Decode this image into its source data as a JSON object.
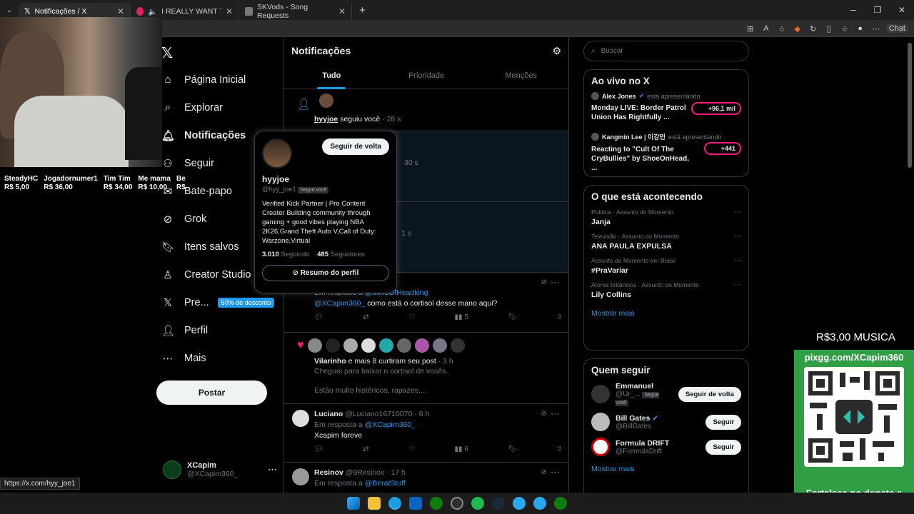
{
  "browser": {
    "tabs": [
      {
        "title": "Notificações / X",
        "active": true
      },
      {
        "title": "I REALLY WANT TO STAY AT Y",
        "active": false
      },
      {
        "title": "SKVods - Song Requests",
        "active": false
      }
    ],
    "chat_label": "Chat"
  },
  "donors": [
    {
      "name": "SteadyHC",
      "amount": "R$ 5,00"
    },
    {
      "name": "Jogadornumer1",
      "amount": "R$ 36,00"
    },
    {
      "name": "Tim Tim",
      "amount": "R$ 34,00"
    },
    {
      "name": "Me mama",
      "amount": "R$ 10,00"
    },
    {
      "name": "Be",
      "amount": "R$"
    }
  ],
  "nav": {
    "items": [
      {
        "label": "Página Inicial",
        "icon": "home-icon"
      },
      {
        "label": "Explorar",
        "icon": "search-icon"
      },
      {
        "label": "Notificações",
        "icon": "bell-icon",
        "active": true
      },
      {
        "label": "Seguir",
        "icon": "follow-icon"
      },
      {
        "label": "Bate-papo",
        "icon": "mail-icon"
      },
      {
        "label": "Grok",
        "icon": "grok-icon"
      },
      {
        "label": "Itens salvos",
        "icon": "bookmark-icon"
      },
      {
        "label": "Creator Studio",
        "icon": "creator-icon"
      },
      {
        "label": "Pre...",
        "icon": "x-icon"
      },
      {
        "label": "Perfil",
        "icon": "person-icon"
      },
      {
        "label": "Mais",
        "icon": "more-icon"
      }
    ],
    "discount_badge": "50% de desconto",
    "post_button": "Postar"
  },
  "account": {
    "name": "XCapim",
    "handle": "@XCapim360_"
  },
  "status_url": "https://x.com/hyy_joe1",
  "main": {
    "title": "Notificações",
    "tabs": [
      "Tudo",
      "Prioridade",
      "Menções"
    ],
    "follow_notif": {
      "user": "hyyjoe",
      "text": "seguiu você",
      "time": "· 28 s"
    },
    "hidden_time_1": "30 s",
    "hidden_time_2": "1 s",
    "reply1": {
      "reply_to_prefix": "Em resposta a",
      "reply_to": "@MindOfHeadking",
      "mention": "@XCapim360_",
      "text": "como está o cortisol desse mano aqui?",
      "views": "5"
    },
    "likes": {
      "user": "Vilarinho",
      "text": "e mais 8 curtiram seu post",
      "time": "· 3 h",
      "post_line1": "Cheguei para baixar o cortisol de vocês.",
      "post_line2": "Estão muito histéricos, rapazes...."
    },
    "reply2": {
      "name": "Luciano",
      "handle": "@Luciano16710070",
      "time": "· 6 h",
      "reply_to_prefix": "Em resposta a",
      "reply_to": "@XCapim360_",
      "text": "Xcapim foreve",
      "views": "6"
    },
    "reply3": {
      "name": "Resinov",
      "handle": "@9Resinov",
      "time": "· 17 h",
      "reply_to_prefix": "Em resposta a",
      "reply_to": "@BeratStuff"
    }
  },
  "popup": {
    "follow_back": "Seguir de volta",
    "name": "hyyjoe",
    "handle": "@hyy_joe1",
    "follows_you": "Segue você",
    "bio": "Verified Kick Partner | Pro Content Creator Building community through gaming + good vibes playing NBA 2K26,Grand Theft Auto V,Call of Duty: Warzone,Virtual",
    "following_count": "3.010",
    "following_label": "Seguindo",
    "followers_count": "485",
    "followers_label": "Seguidores",
    "summary": "Resumo do perfil"
  },
  "right": {
    "search_placeholder": "Buscar",
    "live": {
      "title": "Ao vivo no X",
      "items": [
        {
          "host": "Alex Jones",
          "status": "está apresentando",
          "title": "Monday LIVE: Border Patrol Union Has Rightfully ...",
          "count": "+96,1 mil"
        },
        {
          "host": "Kangmin Lee | 이강민",
          "status": "está apresentando",
          "title": "Reacting to \"Cult Of The CryBullies\" by ShoeOnHead, ...",
          "count": "+441"
        }
      ]
    },
    "trends": {
      "title": "O que está acontecendo",
      "items": [
        {
          "category": "Política · Assunto do Momento",
          "name": "Janja"
        },
        {
          "category": "Televisão · Assunto do Momento",
          "name": "ANA PAULA EXPULSA"
        },
        {
          "category": "Assunto do Momento em Brasil",
          "name": "#PraVariar"
        },
        {
          "category": "Atores britânicos · Assunto do Momento",
          "name": "Lily Collins"
        }
      ],
      "show_more": "Mostrar mais"
    },
    "who": {
      "title": "Quem seguir",
      "items": [
        {
          "name": "Emmanuel",
          "handle": "@Ur_...",
          "badge": "Segue você",
          "button": "Seguir de volta"
        },
        {
          "name": "Bill Gates",
          "handle": "@BillGates",
          "button": "Seguir"
        },
        {
          "name": "Formula DRIFT",
          "handle": "@FormulaDrift",
          "button": "Seguir"
        }
      ],
      "show_more": "Mostrar mais"
    }
  },
  "overlay": {
    "price": "R$3,00 MUSICA",
    "pix_url": "pixgg.com/XCapim360",
    "message": "Fortaleça no donate e envie sua mensagem!"
  }
}
